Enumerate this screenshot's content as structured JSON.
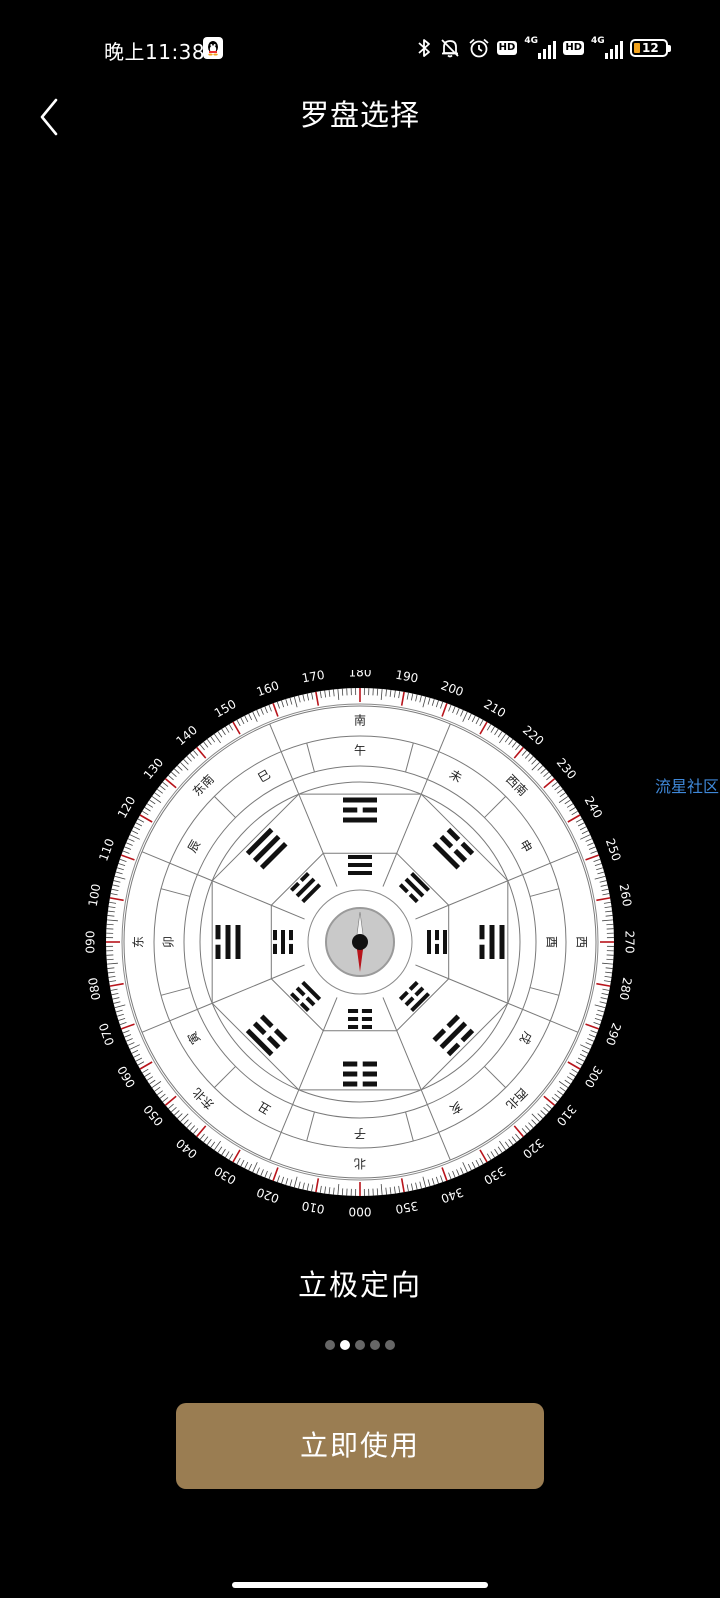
{
  "status_bar": {
    "time": "晚上11:38",
    "icons": [
      "qq-icon",
      "bluetooth-icon",
      "bell-off-icon",
      "alarm-icon",
      "hd-icon",
      "signal-4g-icon",
      "hd-icon",
      "signal-4g-icon",
      "battery-icon"
    ],
    "hd_label": "HD",
    "network_label": "4G",
    "battery_level": "12",
    "battery_color": "#f2a31d"
  },
  "nav": {
    "title": "罗盘选择"
  },
  "compass": {
    "degree_labels": [
      "000",
      "010",
      "020",
      "030",
      "040",
      "050",
      "060",
      "070",
      "080",
      "090",
      "100",
      "110",
      "120",
      "130",
      "140",
      "150",
      "160",
      "170",
      "180",
      "190",
      "200",
      "210",
      "220",
      "230",
      "240",
      "250",
      "260",
      "270",
      "280",
      "290",
      "300",
      "310",
      "320",
      "330",
      "340",
      "350"
    ],
    "direction_ring": [
      {
        "label": "南",
        "angle": 0
      },
      {
        "label": "西南",
        "angle": 45
      },
      {
        "label": "西",
        "angle": 90
      },
      {
        "label": "西北",
        "angle": 135
      },
      {
        "label": "北",
        "angle": 180
      },
      {
        "label": "东北",
        "angle": 225
      },
      {
        "label": "东",
        "angle": 270
      },
      {
        "label": "东南",
        "angle": 315
      }
    ],
    "branch_ring": [
      {
        "label": "午",
        "angle": 0
      },
      {
        "label": "未",
        "angle": 30
      },
      {
        "label": "申",
        "angle": 60
      },
      {
        "label": "酉",
        "angle": 90
      },
      {
        "label": "戌",
        "angle": 120
      },
      {
        "label": "亥",
        "angle": 150
      },
      {
        "label": "子",
        "angle": 180
      },
      {
        "label": "丑",
        "angle": 210
      },
      {
        "label": "寅",
        "angle": 240
      },
      {
        "label": "卯",
        "angle": 270
      },
      {
        "label": "辰",
        "angle": 300
      },
      {
        "label": "巳",
        "angle": 330
      }
    ],
    "outer_trigrams": [
      "101",
      "001",
      "110",
      "010",
      "000",
      "100",
      "011",
      "111"
    ],
    "inner_trigrams": [
      "111",
      "110",
      "101",
      "100",
      "000",
      "001",
      "010",
      "011"
    ],
    "accent_color": "#b8141b"
  },
  "watermark": "流星社区",
  "caption": "立极定向",
  "pager": {
    "count": 5,
    "active_index": 1
  },
  "primary_button": {
    "label": "立即使用",
    "color": "#9a7d52"
  }
}
